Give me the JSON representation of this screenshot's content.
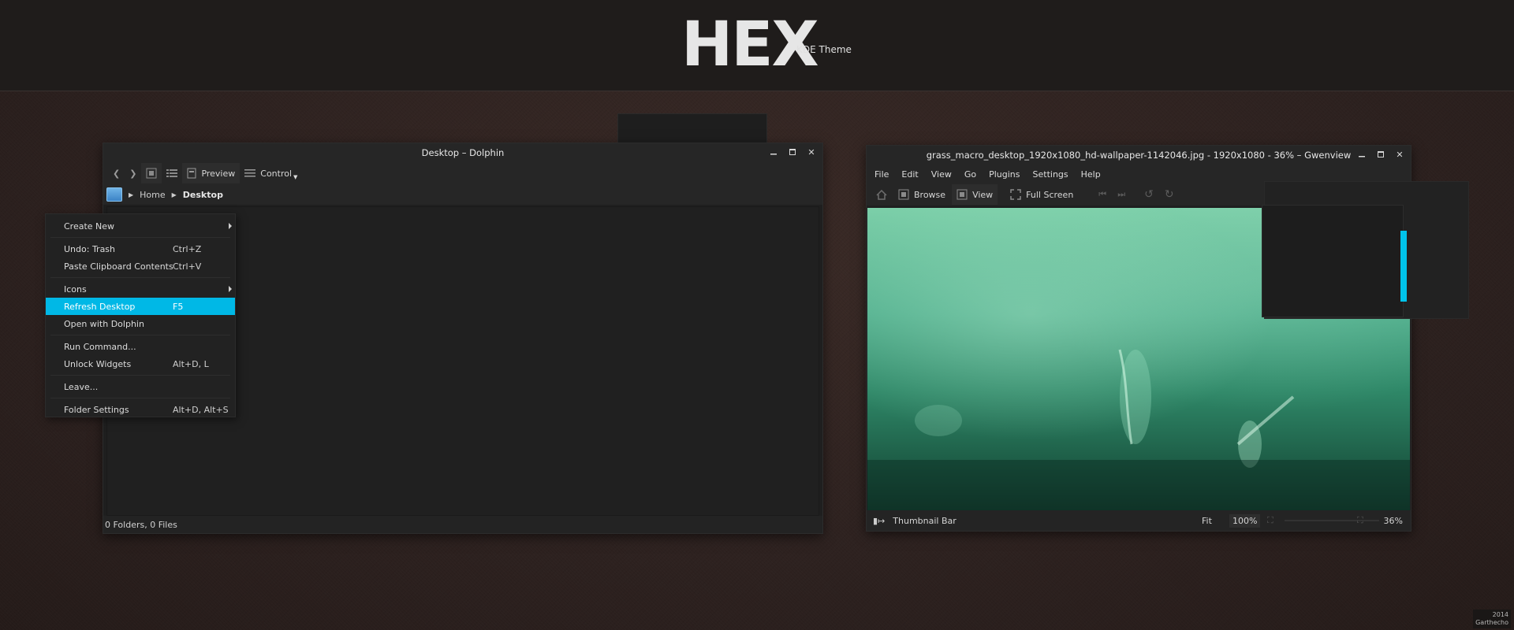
{
  "banner": {
    "title": "HEX",
    "subtitle": "KDE Theme"
  },
  "dolphin": {
    "title": "Desktop – Dolphin",
    "toolbar": {
      "preview_label": "Preview",
      "control_label": "Control"
    },
    "breadcrumb": {
      "home": "Home",
      "current": "Desktop"
    },
    "status": "0 Folders, 0 Files"
  },
  "context_menu": {
    "items": [
      {
        "label": "Create New",
        "shortcut": "",
        "submenu": true
      },
      {
        "label": "Undo: Trash",
        "shortcut": "Ctrl+Z"
      },
      {
        "label": "Paste Clipboard Contents",
        "shortcut": "Ctrl+V"
      },
      {
        "label": "Icons",
        "shortcut": "",
        "submenu": true
      },
      {
        "label": "Refresh Desktop",
        "shortcut": "F5",
        "highlighted": true
      },
      {
        "label": "Open with Dolphin",
        "shortcut": ""
      },
      {
        "label": "Run Command...",
        "shortcut": ""
      },
      {
        "label": "Unlock Widgets",
        "shortcut": "Alt+D, L"
      },
      {
        "label": "Leave...",
        "shortcut": ""
      },
      {
        "label": "Folder Settings",
        "shortcut": "Alt+D, Alt+S"
      }
    ]
  },
  "gwenview": {
    "title": "grass_macro_desktop_1920x1080_hd-wallpaper-1142046.jpg - 1920x1080 - 36% – Gwenview",
    "menu": [
      "File",
      "Edit",
      "View",
      "Go",
      "Plugins",
      "Settings",
      "Help"
    ],
    "toolbar": {
      "browse": "Browse",
      "view": "View",
      "fullscreen": "Full Screen"
    },
    "status": {
      "thumbnail_bar": "Thumbnail Bar",
      "fit": "Fit",
      "zoom_100": "100%",
      "zoom_current": "36%"
    }
  },
  "credit": {
    "line1": "2014",
    "line2": "Garthecho"
  },
  "colors": {
    "accent": "#00b8e6",
    "close": "#e1231b",
    "window_bg": "#1f1f1f"
  }
}
